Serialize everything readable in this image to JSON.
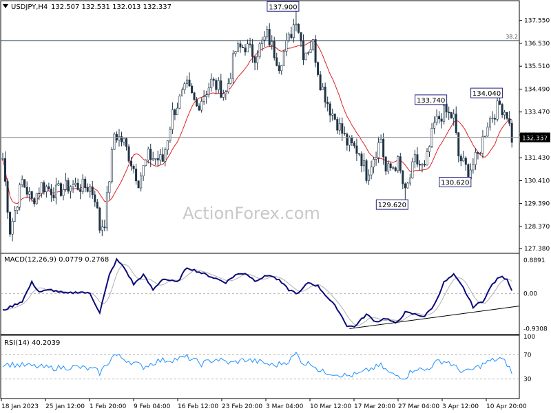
{
  "header": {
    "symbol": "USDJPY,H4",
    "ohlc": "132.507 132.531 132.013 132.337"
  },
  "watermark": "ActionForex.com",
  "colors": {
    "background": "#ffffff",
    "candle": "#1f3344",
    "ma": "#e02020",
    "macd_line": "#0a0a7a",
    "macd_signal": "#b0b0b0",
    "rsi": "#1e90ff",
    "grid_line": "#000000",
    "label_border": "#202080"
  },
  "chart_data": [
    {
      "type": "candlestick",
      "title": "USDJPY,H4",
      "ylim": [
        127.2,
        138.4
      ],
      "y_ticks": [
        "137.550",
        "136.530",
        "135.510",
        "134.490",
        "133.470",
        "132.450",
        "131.430",
        "130.410",
        "129.390",
        "128.370",
        "127.380"
      ],
      "y_tick_values": [
        137.55,
        136.53,
        135.51,
        134.49,
        133.47,
        132.45,
        131.43,
        130.41,
        129.39,
        128.37,
        127.38
      ],
      "current_price": "132.337",
      "current_price_value": 132.337,
      "fib_level": {
        "label": "38.2",
        "value": 136.65
      },
      "x_labels": [
        "18 Jan 2023",
        "25 Jan 12:00",
        "1 Feb 20:00",
        "9 Feb 04:00",
        "16 Feb 12:00",
        "23 Feb 20:00",
        "3 Mar 04:00",
        "10 Mar 12:00",
        "17 Mar 20:00",
        "27 Mar 04:00",
        "3 Apr 12:00",
        "10 Apr 20:00"
      ],
      "annotations": [
        {
          "label": "137.900",
          "value": 137.9,
          "bar": 121
        },
        {
          "label": "129.620",
          "value": 129.62,
          "bar": 166
        },
        {
          "label": "133.740",
          "value": 133.74,
          "bar": 182
        },
        {
          "label": "130.620",
          "value": 130.62,
          "bar": 192
        },
        {
          "label": "134.040",
          "value": 134.04,
          "bar": 205
        }
      ],
      "anchors": [
        [
          0,
          131.4
        ],
        [
          3,
          128.2
        ],
        [
          8,
          130.4
        ],
        [
          12,
          129.5
        ],
        [
          16,
          130.2
        ],
        [
          22,
          129.9
        ],
        [
          28,
          130.2
        ],
        [
          36,
          130.1
        ],
        [
          38,
          129.7
        ],
        [
          40,
          128.3
        ],
        [
          42,
          128.6
        ],
        [
          46,
          132.5
        ],
        [
          50,
          132.1
        ],
        [
          56,
          130.4
        ],
        [
          60,
          131.5
        ],
        [
          66,
          131.3
        ],
        [
          70,
          133.4
        ],
        [
          76,
          134.6
        ],
        [
          80,
          133.7
        ],
        [
          86,
          134.8
        ],
        [
          92,
          134.3
        ],
        [
          96,
          136.2
        ],
        [
          100,
          136.4
        ],
        [
          104,
          136.0
        ],
        [
          109,
          136.9
        ],
        [
          114,
          135.6
        ],
        [
          118,
          136.7
        ],
        [
          121,
          137.7
        ],
        [
          124,
          136.1
        ],
        [
          128,
          136.5
        ],
        [
          131,
          134.8
        ],
        [
          135,
          133.6
        ],
        [
          138,
          133.0
        ],
        [
          142,
          132.1
        ],
        [
          147,
          131.7
        ],
        [
          150,
          130.7
        ],
        [
          156,
          132.3
        ],
        [
          158,
          130.8
        ],
        [
          163,
          131.2
        ],
        [
          166,
          129.8
        ],
        [
          170,
          131.3
        ],
        [
          174,
          130.9
        ],
        [
          178,
          132.9
        ],
        [
          182,
          133.5
        ],
        [
          186,
          133.2
        ],
        [
          188,
          131.5
        ],
        [
          192,
          130.8
        ],
        [
          196,
          131.5
        ],
        [
          200,
          133.0
        ],
        [
          205,
          133.8
        ],
        [
          208,
          133.4
        ],
        [
          210,
          132.3
        ]
      ]
    },
    {
      "type": "line",
      "title": "MACD(12,26,9) 0.0779 0.2768",
      "ylim": [
        -1.05,
        1.0
      ],
      "y_ticks": [
        "0.8891",
        "0.00",
        "-0.9308"
      ],
      "y_tick_values": [
        0.8891,
        0.0,
        -0.9308
      ],
      "series_names": [
        "MACD",
        "Signal"
      ],
      "trendline": {
        "from": [
          143,
          -0.93
        ],
        "to": [
          230,
          -0.33
        ]
      },
      "anchors": [
        [
          0,
          -0.45
        ],
        [
          8,
          -0.2
        ],
        [
          12,
          0.3
        ],
        [
          15,
          0.05
        ],
        [
          20,
          0.1
        ],
        [
          26,
          0.0
        ],
        [
          32,
          0.05
        ],
        [
          36,
          0.0
        ],
        [
          40,
          -0.5
        ],
        [
          44,
          0.5
        ],
        [
          47,
          0.9
        ],
        [
          50,
          0.7
        ],
        [
          54,
          0.25
        ],
        [
          58,
          0.5
        ],
        [
          62,
          0.1
        ],
        [
          66,
          0.4
        ],
        [
          72,
          0.3
        ],
        [
          76,
          0.7
        ],
        [
          80,
          0.6
        ],
        [
          86,
          0.45
        ],
        [
          92,
          0.3
        ],
        [
          96,
          0.5
        ],
        [
          100,
          0.55
        ],
        [
          104,
          0.35
        ],
        [
          110,
          0.5
        ],
        [
          114,
          0.35
        ],
        [
          118,
          0.1
        ],
        [
          122,
          0.0
        ],
        [
          126,
          0.3
        ],
        [
          130,
          0.2
        ],
        [
          134,
          -0.1
        ],
        [
          138,
          -0.4
        ],
        [
          142,
          -0.85
        ],
        [
          145,
          -0.88
        ],
        [
          150,
          -0.55
        ],
        [
          154,
          -0.75
        ],
        [
          158,
          -0.65
        ],
        [
          162,
          -0.8
        ],
        [
          166,
          -0.5
        ],
        [
          170,
          -0.55
        ],
        [
          174,
          -0.6
        ],
        [
          178,
          -0.3
        ],
        [
          182,
          0.3
        ],
        [
          186,
          0.5
        ],
        [
          190,
          0.15
        ],
        [
          194,
          -0.35
        ],
        [
          198,
          -0.2
        ],
        [
          202,
          0.25
        ],
        [
          205,
          0.45
        ],
        [
          208,
          0.4
        ],
        [
          210,
          0.08
        ]
      ]
    },
    {
      "type": "line",
      "title": "RSI(14) 40.2039",
      "ylim": [
        0,
        100
      ],
      "y_ticks": [
        "100",
        "70",
        "30",
        "0"
      ],
      "y_tick_values": [
        100,
        70,
        30,
        0
      ],
      "reference_lines": [
        70,
        30
      ],
      "anchors": [
        [
          0,
          55
        ],
        [
          10,
          52
        ],
        [
          20,
          48
        ],
        [
          30,
          50
        ],
        [
          38,
          45
        ],
        [
          40,
          40
        ],
        [
          46,
          70
        ],
        [
          52,
          60
        ],
        [
          58,
          50
        ],
        [
          64,
          60
        ],
        [
          70,
          62
        ],
        [
          76,
          66
        ],
        [
          82,
          55
        ],
        [
          88,
          63
        ],
        [
          94,
          56
        ],
        [
          100,
          62
        ],
        [
          106,
          58
        ],
        [
          112,
          52
        ],
        [
          118,
          60
        ],
        [
          121,
          72
        ],
        [
          124,
          56
        ],
        [
          128,
          55
        ],
        [
          131,
          42
        ],
        [
          136,
          40
        ],
        [
          142,
          35
        ],
        [
          147,
          38
        ],
        [
          152,
          47
        ],
        [
          156,
          52
        ],
        [
          160,
          38
        ],
        [
          166,
          33
        ],
        [
          170,
          48
        ],
        [
          174,
          44
        ],
        [
          180,
          60
        ],
        [
          184,
          58
        ],
        [
          188,
          45
        ],
        [
          192,
          42
        ],
        [
          196,
          50
        ],
        [
          200,
          58
        ],
        [
          205,
          64
        ],
        [
          208,
          55
        ],
        [
          210,
          40
        ]
      ]
    }
  ]
}
